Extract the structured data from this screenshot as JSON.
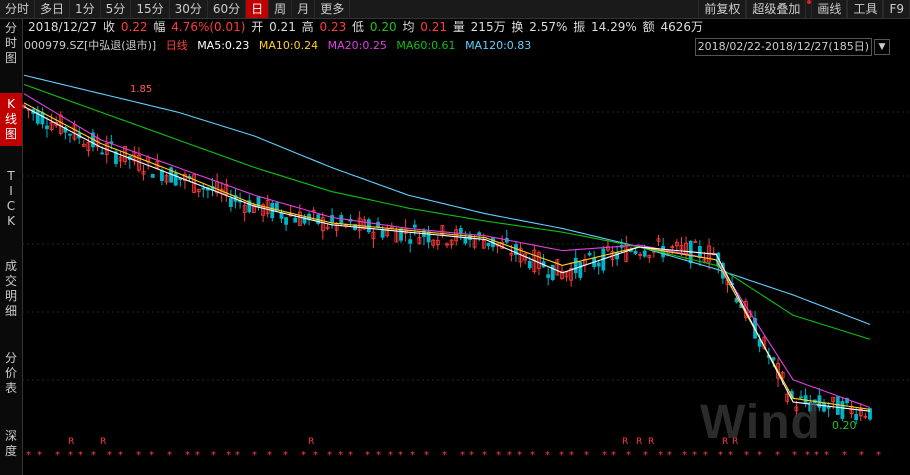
{
  "toolbar": {
    "tabs": [
      {
        "label": "分时",
        "active": false
      },
      {
        "label": "多日",
        "active": false
      },
      {
        "label": "1分",
        "active": false
      },
      {
        "label": "5分",
        "active": false
      },
      {
        "label": "15分",
        "active": false
      },
      {
        "label": "30分",
        "active": false
      },
      {
        "label": "60分",
        "active": false
      },
      {
        "label": "日",
        "active": true
      },
      {
        "label": "周",
        "active": false
      },
      {
        "label": "月",
        "active": false
      },
      {
        "label": "更多",
        "active": false
      }
    ],
    "right": [
      "前复权",
      "超级叠加",
      "画线",
      "工具",
      "F9"
    ]
  },
  "quote": {
    "date": "2018/12/27",
    "close_label": "收",
    "close": "0.22",
    "change_label": "幅",
    "change": "4.76%(0.01)",
    "open_label": "开",
    "open": "0.21",
    "high_label": "高",
    "high": "0.23",
    "low_label": "低",
    "low": "0.20",
    "avg_label": "均",
    "avg": "0.21",
    "volume_label": "量",
    "volume": "215万",
    "turnover_label": "换",
    "turnover": "2.57%",
    "amplitude_label": "振",
    "amplitude": "14.29%",
    "amount_label": "额",
    "amount": "4626万"
  },
  "sidebar": {
    "tabs": [
      "分时图",
      "K线图",
      "TICK",
      "成交明细",
      "分价表",
      "深度"
    ]
  },
  "legend": {
    "code": "000979.SZ",
    "name": "[中弘退(退市)]",
    "series_label": "日线",
    "ma5": "MA5:0.23",
    "ma10": "MA10:0.24",
    "ma20": "MA20:0.25",
    "ma60": "MA60:0.61",
    "ma120": "MA120:0.83"
  },
  "range": "2018/02/22-2018/12/27(185日)",
  "colors": {
    "up": "#ff3b3b",
    "down": "#00b4c8",
    "ma5": "#ffffff",
    "ma10": "#ffd21e",
    "ma20": "#e040e0",
    "ma60": "#10c010",
    "ma120": "#60d0ff"
  },
  "chart_data": {
    "type": "line",
    "annotations": [
      "1.85",
      "0.20"
    ],
    "series": [
      {
        "name": "MA120",
        "values": [
          2.05,
          1.95,
          1.85,
          1.72,
          1.55,
          1.4,
          1.3,
          1.22,
          1.12,
          1.0,
          0.86,
          0.7
        ]
      },
      {
        "name": "MA60",
        "values": [
          2.0,
          1.85,
          1.7,
          1.55,
          1.42,
          1.33,
          1.26,
          1.2,
          1.12,
          1.02,
          0.75,
          0.62
        ]
      },
      {
        "name": "MA20",
        "values": [
          1.95,
          1.7,
          1.55,
          1.4,
          1.28,
          1.22,
          1.18,
          1.1,
          1.13,
          1.05,
          0.4,
          0.25
        ]
      },
      {
        "name": "MA10",
        "values": [
          1.9,
          1.68,
          1.52,
          1.35,
          1.25,
          1.21,
          1.17,
          1.02,
          1.12,
          1.05,
          0.3,
          0.24
        ]
      },
      {
        "name": "MA5",
        "values": [
          1.88,
          1.66,
          1.5,
          1.34,
          1.24,
          1.2,
          1.16,
          0.98,
          1.12,
          1.08,
          0.28,
          0.23
        ]
      }
    ]
  },
  "footer_marks": {
    "r": "R",
    "star": "*"
  },
  "watermark": "Wind"
}
